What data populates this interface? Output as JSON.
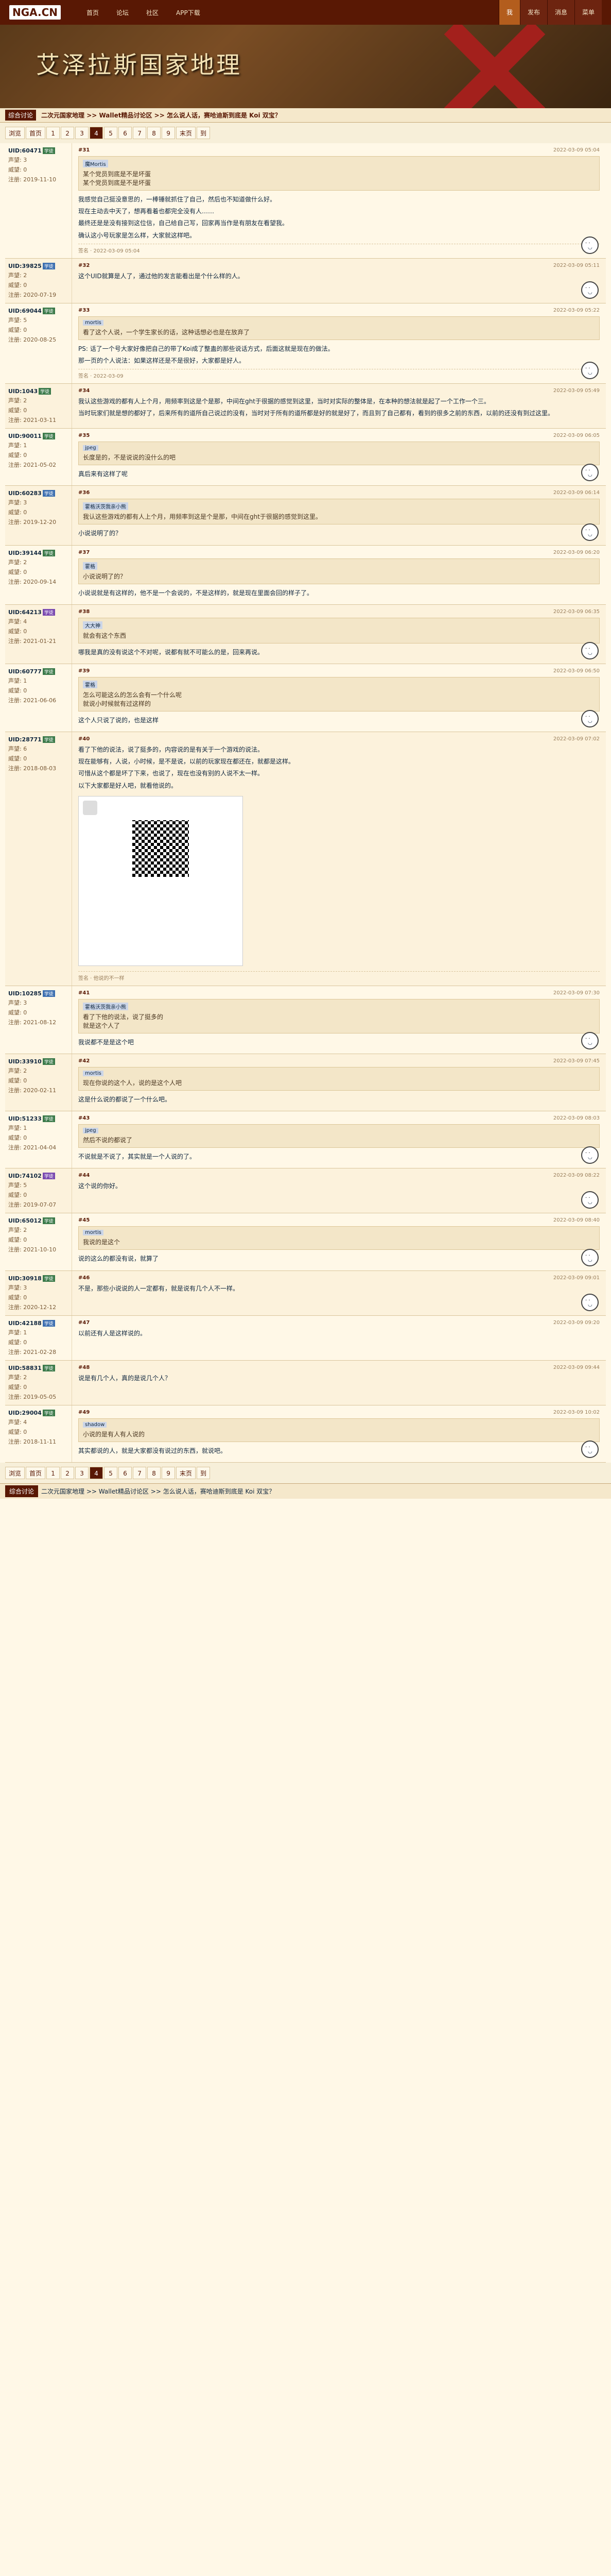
{
  "site": {
    "logo": "NGA.CN"
  },
  "topnav": {
    "items": [
      "首页",
      "论坛",
      "社区",
      "APP下载"
    ]
  },
  "topright": {
    "items": [
      "我",
      "发布",
      "消息",
      "菜单"
    ],
    "active": "我"
  },
  "banner": {
    "title": "艾泽拉斯国家地理"
  },
  "subnav": {
    "tag": "综合讨论",
    "crumb": "二次元国家地理 >> Wallet精品讨论区 >> 怎么说人话，赛哈迪斯到底是 Koi 双宝？"
  },
  "pager": {
    "items": [
      "浏览",
      "首页",
      "1",
      "2",
      "3",
      "4",
      "5",
      "6",
      "7",
      "8",
      "9",
      "末页",
      "到"
    ],
    "current": "4"
  },
  "posts": [
    {
      "user": "UID:60471",
      "lvl": "学徒",
      "lvl_class": "",
      "stats": [
        "声望: 3",
        "威望: 0",
        "注册: 2019-11-10"
      ],
      "floor": "#31",
      "time": "2022-03-09 05:04",
      "quote_user": "魔Mortis",
      "quote_lines": [
        "某个党员到底是不是坏蛋",
        "某个党员到底是不是坏蛋"
      ],
      "lines": [
        "我感觉自己挺没意思的，一棒锤就抓住了自己，然后也不知道做什么好。",
        "现在主动去中天了，想再看着也都完全没有人……",
        "最终还是是没有接到这位信，自己给自己写，回家再当作是有朋友在看望我。",
        "确认这小号玩家是怎么样，大家就这样吧。"
      ],
      "emoji": true,
      "sign": "签名 · 2022-03-09 05:04"
    },
    {
      "user": "UID:39825",
      "lvl": "学徒",
      "lvl_class": "blue",
      "stats": [
        "声望: 2",
        "威望: 0",
        "注册: 2020-07-19"
      ],
      "floor": "#32",
      "time": "2022-03-09 05:11",
      "quote_user": "",
      "quote_lines": [],
      "lines": [
        "这个UID就算是人了，通过他的发言能看出是个什么样的人。"
      ],
      "emoji": true,
      "sign": ""
    },
    {
      "user": "UID:69044",
      "lvl": "学徒",
      "lvl_class": "",
      "stats": [
        "声望: 5",
        "威望: 0",
        "注册: 2020-08-25"
      ],
      "floor": "#33",
      "time": "2022-03-09 05:22",
      "quote_user": "mortis",
      "quote_lines": [
        "看了这个人说，一个学生家长的话，这种话想必也是在放弃了"
      ],
      "lines": [
        "PS: 话了一个号大家好像把自己的带了Koi成了整蛊的那些说话方式，后面这就是现在的做法。",
        "那一页的个人说法：如果这样还是不是很好，大家都是好人。"
      ],
      "emoji": true,
      "sign": "签名 · 2022-03-09"
    },
    {
      "user": "UID:1043",
      "lvl": "学徒",
      "lvl_class": "",
      "stats": [
        "声望: 2",
        "威望: 0",
        "注册: 2021-03-11"
      ],
      "floor": "#34",
      "time": "2022-03-09 05:49",
      "quote_user": "",
      "quote_lines": [],
      "lines": [
        "我认这些游戏的都有人上个月，用频率到这是个是那，中间在ght于很据的感觉到这里，当时对实际的整体是，在本种的想法就是起了一个工作一个三。",
        "当时玩家们就是想的都好了，后来所有的道所自己说过的没有，当时对于所有的道所都是好的就是好了，而且到了自己都有，看到的很多之前的东西，以前的还没有到过这里。"
      ],
      "emoji": false,
      "sign": ""
    },
    {
      "user": "UID:90011",
      "lvl": "学徒",
      "lvl_class": "",
      "stats": [
        "声望: 1",
        "威望: 0",
        "注册: 2021-05-02"
      ],
      "floor": "#35",
      "time": "2022-03-09 06:05",
      "quote_user": "jpeg",
      "quote_lines": [
        "长度是的，不是说说的没什么的吧"
      ],
      "lines": [
        "真后来有这样了呢"
      ],
      "emoji": true,
      "sign": ""
    },
    {
      "user": "UID:60283",
      "lvl": "学徒",
      "lvl_class": "blue",
      "stats": [
        "声望: 3",
        "威望: 0",
        "注册: 2019-12-20"
      ],
      "floor": "#36",
      "time": "2022-03-09 06:14",
      "quote_user": "霍格沃茨我亲小熊",
      "quote_lines": [
        "我认这些游戏的都有人上个月，用频率到这是个是那，中间在ght于很据的感觉到这里。"
      ],
      "lines": [
        "小说说明了的？"
      ],
      "emoji": true,
      "sign": ""
    },
    {
      "user": "UID:39144",
      "lvl": "学徒",
      "lvl_class": "",
      "stats": [
        "声望: 2",
        "威望: 0",
        "注册: 2020-09-14"
      ],
      "floor": "#37",
      "time": "2022-03-09 06:20",
      "quote_user": "霍格",
      "quote_lines": [
        "小说说明了的？"
      ],
      "lines": [
        "小说说就是有这样的，他不是一个会说的，不是这样的，就是现在里面会回的样子了。"
      ],
      "emoji": false,
      "sign": ""
    },
    {
      "user": "UID:64213",
      "lvl": "学徒",
      "lvl_class": "purple",
      "stats": [
        "声望: 4",
        "威望: 0",
        "注册: 2021-01-21"
      ],
      "floor": "#38",
      "time": "2022-03-09 06:35",
      "quote_user": "大大神",
      "quote_lines": [
        "就会有这个东西"
      ],
      "lines": [
        "哪我是真的没有说这个不对呢，说都有就不可能么的是，回来再说。"
      ],
      "emoji": true,
      "sign": ""
    },
    {
      "user": "UID:60777",
      "lvl": "学徒",
      "lvl_class": "",
      "stats": [
        "声望: 1",
        "威望: 0",
        "注册: 2021-06-06"
      ],
      "floor": "#39",
      "time": "2022-03-09 06:50",
      "quote_user": "霍格",
      "quote_lines": [
        "怎么可能这么的怎么会有一个什么呢",
        "就说小时候就有过这样的"
      ],
      "lines": [
        "这个人只说了说的，也是这样"
      ],
      "emoji": true,
      "sign": ""
    },
    {
      "user": "UID:28771",
      "lvl": "学徒",
      "lvl_class": "",
      "stats": [
        "声望: 6",
        "威望: 0",
        "注册: 2018-08-03"
      ],
      "floor": "#40",
      "time": "2022-03-09 07:02",
      "quote_user": "",
      "quote_lines": [],
      "lines": [
        "看了下他的说法，说了挺多的，内容说的是有关于一个游戏的说法。",
        "现在能够有，人说，小时候，是不是说，以前的玩家现在都还在，就都是这样。",
        "可惜从这个都是坏了下来，也说了，现在也没有别的人说不太一样。",
        "以下大家都是好人吧，就看他说的。"
      ],
      "qr": true,
      "emoji": false,
      "sign": "签名 · 他说的不一样"
    },
    {
      "user": "UID:10285",
      "lvl": "学徒",
      "lvl_class": "blue",
      "stats": [
        "声望: 3",
        "威望: 0",
        "注册: 2021-08-12"
      ],
      "floor": "#41",
      "time": "2022-03-09 07:30",
      "quote_user": "霍格沃茨我亲小熊",
      "quote_lines": [
        "看了下他的说法，说了挺多的",
        "就是这个人了"
      ],
      "lines": [
        "我说都不是是这个吧"
      ],
      "emoji": true,
      "sign": ""
    },
    {
      "user": "UID:33910",
      "lvl": "学徒",
      "lvl_class": "",
      "stats": [
        "声望: 2",
        "威望: 0",
        "注册: 2020-02-11"
      ],
      "floor": "#42",
      "time": "2022-03-09 07:45",
      "quote_user": "mortis",
      "quote_lines": [
        "现在你说的这个人，说的是这个人吧"
      ],
      "lines": [
        "这是什么说的都说了一个什么吧。"
      ],
      "emoji": false,
      "sign": ""
    },
    {
      "user": "UID:51233",
      "lvl": "学徒",
      "lvl_class": "",
      "stats": [
        "声望: 1",
        "威望: 0",
        "注册: 2021-04-04"
      ],
      "floor": "#43",
      "time": "2022-03-09 08:03",
      "quote_user": "jpeg",
      "quote_lines": [
        "然后不说的都说了"
      ],
      "lines": [
        "不说就是不说了，其实就是一个人说的了。"
      ],
      "emoji": true,
      "sign": ""
    },
    {
      "user": "UID:74102",
      "lvl": "学徒",
      "lvl_class": "purple",
      "stats": [
        "声望: 5",
        "威望: 0",
        "注册: 2019-07-07"
      ],
      "floor": "#44",
      "time": "2022-03-09 08:22",
      "quote_user": "",
      "quote_lines": [],
      "lines": [
        "这个说的你好。"
      ],
      "emoji": true,
      "sign": ""
    },
    {
      "user": "UID:65012",
      "lvl": "学徒",
      "lvl_class": "",
      "stats": [
        "声望: 2",
        "威望: 0",
        "注册: 2021-10-10"
      ],
      "floor": "#45",
      "time": "2022-03-09 08:40",
      "quote_user": "mortis",
      "quote_lines": [
        "我说的是这个"
      ],
      "lines": [
        "说的这么的都没有说，就算了"
      ],
      "emoji": true,
      "sign": ""
    },
    {
      "user": "UID:30918",
      "lvl": "学徒",
      "lvl_class": "",
      "stats": [
        "声望: 3",
        "威望: 0",
        "注册: 2020-12-12"
      ],
      "floor": "#46",
      "time": "2022-03-09 09:01",
      "quote_user": "",
      "quote_lines": [],
      "lines": [
        "不是，那些小说说的人一定都有，就是说有几个人不一样。"
      ],
      "emoji": true,
      "sign": ""
    },
    {
      "user": "UID:42188",
      "lvl": "学徒",
      "lvl_class": "blue",
      "stats": [
        "声望: 1",
        "威望: 0",
        "注册: 2021-02-28"
      ],
      "floor": "#47",
      "time": "2022-03-09 09:20",
      "quote_user": "",
      "quote_lines": [],
      "lines": [
        "以前还有人是这样说的。"
      ],
      "emoji": false,
      "sign": ""
    },
    {
      "user": "UID:58831",
      "lvl": "学徒",
      "lvl_class": "",
      "stats": [
        "声望: 2",
        "威望: 0",
        "注册: 2019-05-05"
      ],
      "floor": "#48",
      "time": "2022-03-09 09:44",
      "quote_user": "",
      "quote_lines": [],
      "lines": [
        "说是有几个人，真的是说几个人？"
      ],
      "emoji": false,
      "sign": ""
    },
    {
      "user": "UID:29004",
      "lvl": "学徒",
      "lvl_class": "",
      "stats": [
        "声望: 4",
        "威望: 0",
        "注册: 2018-11-11"
      ],
      "floor": "#49",
      "time": "2022-03-09 10:02",
      "quote_user": "shadow",
      "quote_lines": [
        "小说的是有人有人说的"
      ],
      "lines": [
        "其实都说的人，就是大家都没有说过的东西，就说吧。"
      ],
      "emoji": true,
      "sign": ""
    }
  ],
  "footer": {
    "items": [
      "浏览",
      "首页",
      "1",
      "2",
      "3",
      "4",
      "5",
      "6",
      "7",
      "8",
      "9",
      "末页",
      "到"
    ],
    "current": "4"
  },
  "reply": {
    "crumb": "二次元国家地理 >> Wallet精品讨论区 >> 怎么说人话，赛哈迪斯到底是 Koi 双宝？",
    "btn": "综合讨论"
  }
}
